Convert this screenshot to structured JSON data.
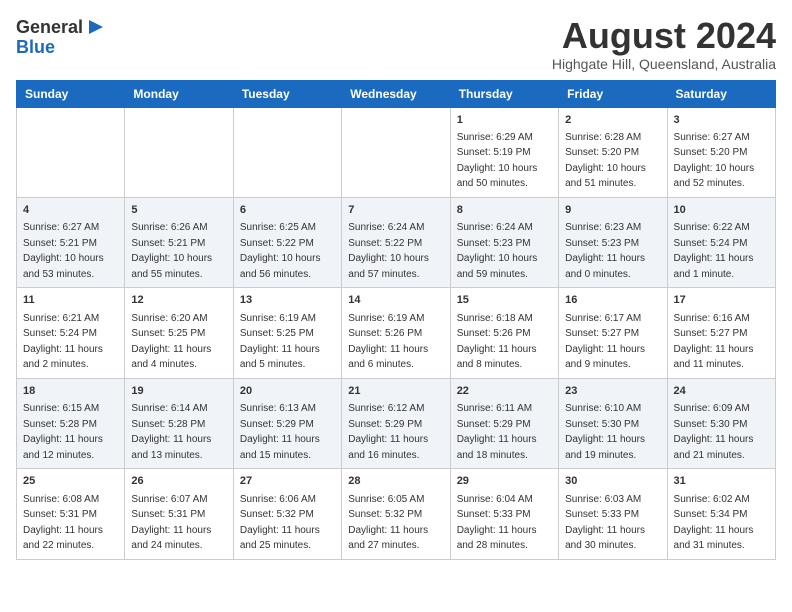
{
  "logo": {
    "general": "General",
    "blue": "Blue"
  },
  "title": "August 2024",
  "subtitle": "Highgate Hill, Queensland, Australia",
  "days_of_week": [
    "Sunday",
    "Monday",
    "Tuesday",
    "Wednesday",
    "Thursday",
    "Friday",
    "Saturday"
  ],
  "weeks": [
    [
      {
        "day": "",
        "info": ""
      },
      {
        "day": "",
        "info": ""
      },
      {
        "day": "",
        "info": ""
      },
      {
        "day": "",
        "info": ""
      },
      {
        "day": "1",
        "info": "Sunrise: 6:29 AM\nSunset: 5:19 PM\nDaylight: 10 hours\nand 50 minutes."
      },
      {
        "day": "2",
        "info": "Sunrise: 6:28 AM\nSunset: 5:20 PM\nDaylight: 10 hours\nand 51 minutes."
      },
      {
        "day": "3",
        "info": "Sunrise: 6:27 AM\nSunset: 5:20 PM\nDaylight: 10 hours\nand 52 minutes."
      }
    ],
    [
      {
        "day": "4",
        "info": "Sunrise: 6:27 AM\nSunset: 5:21 PM\nDaylight: 10 hours\nand 53 minutes."
      },
      {
        "day": "5",
        "info": "Sunrise: 6:26 AM\nSunset: 5:21 PM\nDaylight: 10 hours\nand 55 minutes."
      },
      {
        "day": "6",
        "info": "Sunrise: 6:25 AM\nSunset: 5:22 PM\nDaylight: 10 hours\nand 56 minutes."
      },
      {
        "day": "7",
        "info": "Sunrise: 6:24 AM\nSunset: 5:22 PM\nDaylight: 10 hours\nand 57 minutes."
      },
      {
        "day": "8",
        "info": "Sunrise: 6:24 AM\nSunset: 5:23 PM\nDaylight: 10 hours\nand 59 minutes."
      },
      {
        "day": "9",
        "info": "Sunrise: 6:23 AM\nSunset: 5:23 PM\nDaylight: 11 hours\nand 0 minutes."
      },
      {
        "day": "10",
        "info": "Sunrise: 6:22 AM\nSunset: 5:24 PM\nDaylight: 11 hours\nand 1 minute."
      }
    ],
    [
      {
        "day": "11",
        "info": "Sunrise: 6:21 AM\nSunset: 5:24 PM\nDaylight: 11 hours\nand 2 minutes."
      },
      {
        "day": "12",
        "info": "Sunrise: 6:20 AM\nSunset: 5:25 PM\nDaylight: 11 hours\nand 4 minutes."
      },
      {
        "day": "13",
        "info": "Sunrise: 6:19 AM\nSunset: 5:25 PM\nDaylight: 11 hours\nand 5 minutes."
      },
      {
        "day": "14",
        "info": "Sunrise: 6:19 AM\nSunset: 5:26 PM\nDaylight: 11 hours\nand 6 minutes."
      },
      {
        "day": "15",
        "info": "Sunrise: 6:18 AM\nSunset: 5:26 PM\nDaylight: 11 hours\nand 8 minutes."
      },
      {
        "day": "16",
        "info": "Sunrise: 6:17 AM\nSunset: 5:27 PM\nDaylight: 11 hours\nand 9 minutes."
      },
      {
        "day": "17",
        "info": "Sunrise: 6:16 AM\nSunset: 5:27 PM\nDaylight: 11 hours\nand 11 minutes."
      }
    ],
    [
      {
        "day": "18",
        "info": "Sunrise: 6:15 AM\nSunset: 5:28 PM\nDaylight: 11 hours\nand 12 minutes."
      },
      {
        "day": "19",
        "info": "Sunrise: 6:14 AM\nSunset: 5:28 PM\nDaylight: 11 hours\nand 13 minutes."
      },
      {
        "day": "20",
        "info": "Sunrise: 6:13 AM\nSunset: 5:29 PM\nDaylight: 11 hours\nand 15 minutes."
      },
      {
        "day": "21",
        "info": "Sunrise: 6:12 AM\nSunset: 5:29 PM\nDaylight: 11 hours\nand 16 minutes."
      },
      {
        "day": "22",
        "info": "Sunrise: 6:11 AM\nSunset: 5:29 PM\nDaylight: 11 hours\nand 18 minutes."
      },
      {
        "day": "23",
        "info": "Sunrise: 6:10 AM\nSunset: 5:30 PM\nDaylight: 11 hours\nand 19 minutes."
      },
      {
        "day": "24",
        "info": "Sunrise: 6:09 AM\nSunset: 5:30 PM\nDaylight: 11 hours\nand 21 minutes."
      }
    ],
    [
      {
        "day": "25",
        "info": "Sunrise: 6:08 AM\nSunset: 5:31 PM\nDaylight: 11 hours\nand 22 minutes."
      },
      {
        "day": "26",
        "info": "Sunrise: 6:07 AM\nSunset: 5:31 PM\nDaylight: 11 hours\nand 24 minutes."
      },
      {
        "day": "27",
        "info": "Sunrise: 6:06 AM\nSunset: 5:32 PM\nDaylight: 11 hours\nand 25 minutes."
      },
      {
        "day": "28",
        "info": "Sunrise: 6:05 AM\nSunset: 5:32 PM\nDaylight: 11 hours\nand 27 minutes."
      },
      {
        "day": "29",
        "info": "Sunrise: 6:04 AM\nSunset: 5:33 PM\nDaylight: 11 hours\nand 28 minutes."
      },
      {
        "day": "30",
        "info": "Sunrise: 6:03 AM\nSunset: 5:33 PM\nDaylight: 11 hours\nand 30 minutes."
      },
      {
        "day": "31",
        "info": "Sunrise: 6:02 AM\nSunset: 5:34 PM\nDaylight: 11 hours\nand 31 minutes."
      }
    ]
  ],
  "accent_color": "#1a6bbf"
}
